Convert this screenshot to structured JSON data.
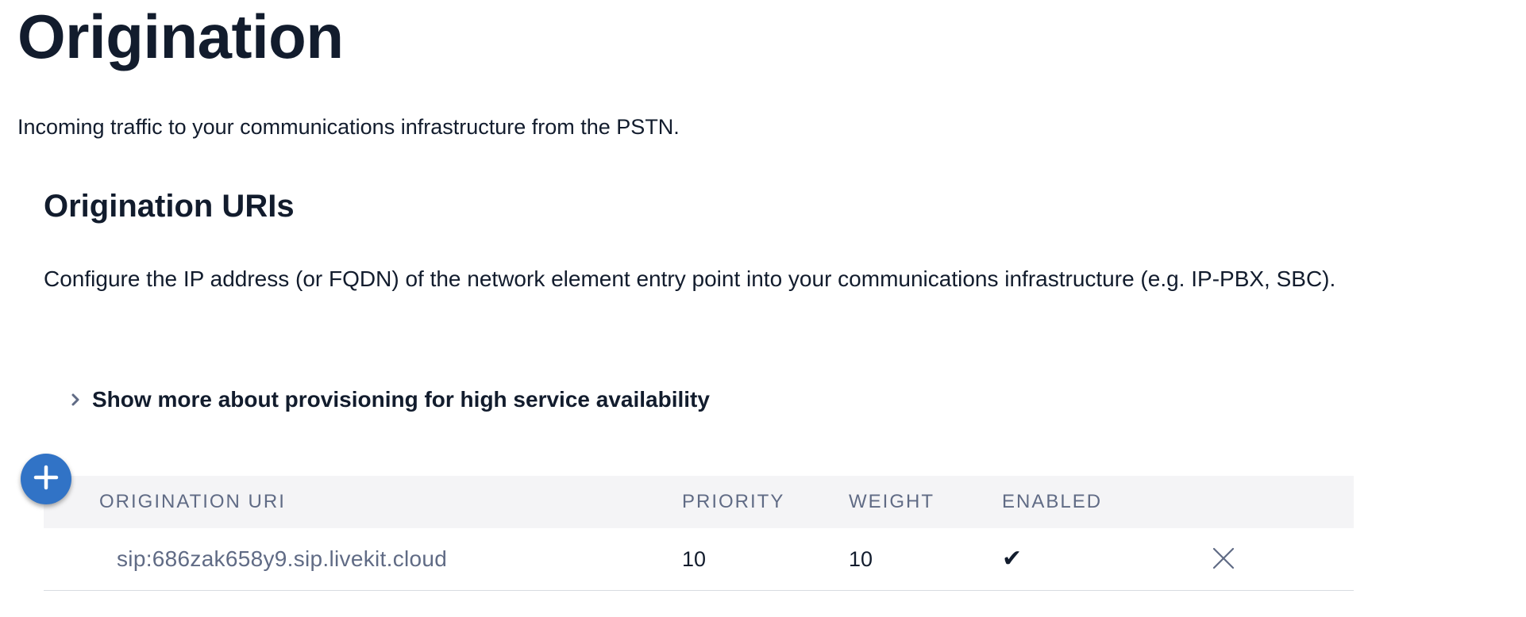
{
  "page": {
    "title": "Origination",
    "subtitle": "Incoming traffic to your communications infrastructure from the PSTN."
  },
  "section": {
    "title": "Origination URIs",
    "description": "Configure the IP address (or FQDN) of the network element entry point into your communications infrastructure (e.g. IP-PBX, SBC).",
    "disclosure_label": "Show more about provisioning for high service availability",
    "disclosure_icon": "chevron-right-icon"
  },
  "add_button": {
    "icon": "plus-icon",
    "color": "#3173c6"
  },
  "table": {
    "columns": {
      "uri": "ORIGINATION URI",
      "priority": "PRIORITY",
      "weight": "WEIGHT",
      "enabled": "ENABLED"
    },
    "rows": [
      {
        "uri": "sip:686zak658y9.sip.livekit.cloud",
        "priority": "10",
        "weight": "10",
        "enabled": "✔",
        "delete_icon": "close-icon"
      }
    ]
  },
  "colors": {
    "text": "#121c2d",
    "muted": "#606b85",
    "header_bg": "#f4f4f6",
    "accent": "#3173c6"
  }
}
